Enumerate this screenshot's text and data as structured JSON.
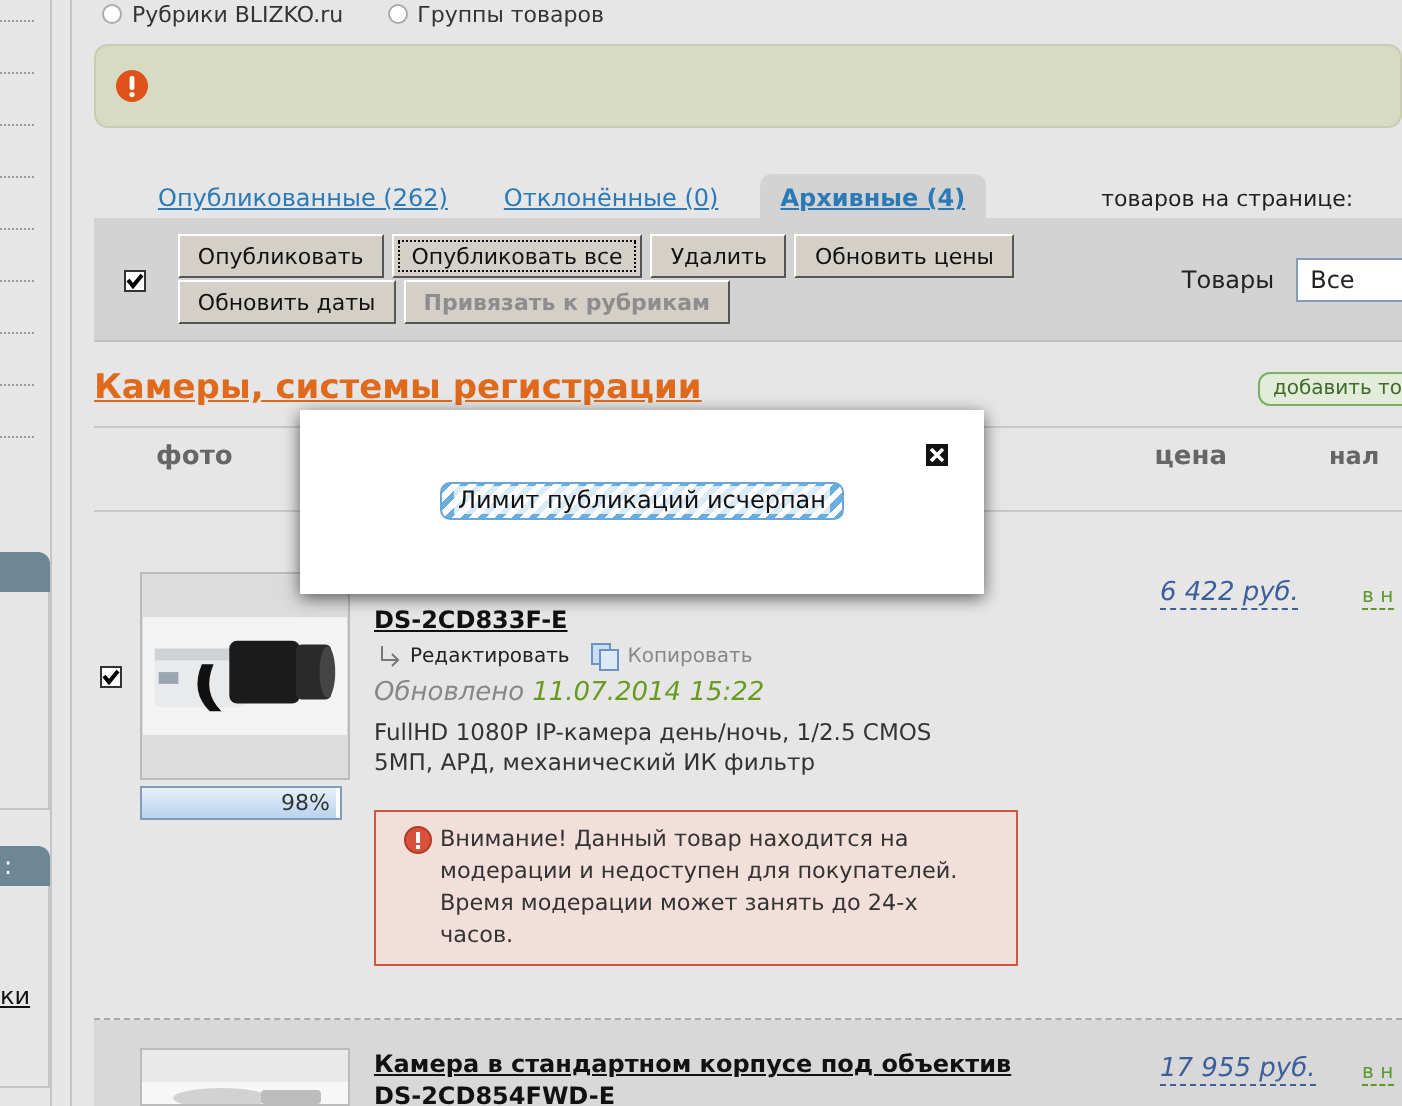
{
  "top_filter": [
    {
      "label": "Рубрики BLIZKO.ru",
      "selected": false
    },
    {
      "label": "Группы товаров",
      "selected": false
    }
  ],
  "sidebar": {
    "panel_title": ":",
    "link": "ки"
  },
  "alert": {
    "kind": "error"
  },
  "tabs": [
    {
      "label": "Опубликованные (262)",
      "selected": false
    },
    {
      "label": "Отклонённые (0)",
      "selected": false
    },
    {
      "label": "Архивные (4)",
      "selected": true
    }
  ],
  "per_page_label": "товаров на странице:",
  "toolbar": {
    "select_all_checked": true,
    "button_rows": [
      [
        {
          "label": "Опубликовать",
          "focused": false,
          "disabled": false
        },
        {
          "label": "Опубликовать все",
          "focused": true,
          "disabled": false
        },
        {
          "label": "Удалить",
          "focused": false,
          "disabled": false
        },
        {
          "label": "Обновить цены",
          "focused": false,
          "disabled": false
        }
      ],
      [
        {
          "label": "Обновить даты",
          "focused": false,
          "disabled": false
        },
        {
          "label": "Привязать к рубрикам",
          "focused": false,
          "disabled": true
        }
      ]
    ],
    "filter": {
      "label": "Товары",
      "value": "Все"
    }
  },
  "section": {
    "title": "Камеры, системы регистрации",
    "add_button": "добавить то"
  },
  "table": {
    "columns": [
      "фото",
      "цена",
      "нал"
    ],
    "rows": [
      {
        "checked": true,
        "title": "DS-2CD833F-E",
        "edit": "Редактировать",
        "copy": "Копировать",
        "updated_label": "Обновлено",
        "updated_date": "11.07.2014 15:22",
        "description": "FullHD 1080P IP-камера день/ночь, 1/2.5 CMOS 5МП, АРД, механический ИК фильтр",
        "upload": {
          "level": 0.98,
          "reading": "98%"
        },
        "warning": "Внимание! Данный товар находится на модерации и недоступен для покупателей. Время модерации может занять до 24-х часов.",
        "price": "6 422 руб.",
        "stock": "в н"
      },
      {
        "title": "Камера в стандартном корпусе под объектив\nDS-2CD854FWD-E",
        "price": "17 955 руб.",
        "stock": "в н"
      }
    ]
  },
  "modal": {
    "message": "Лимит публикаций исчерпан"
  }
}
